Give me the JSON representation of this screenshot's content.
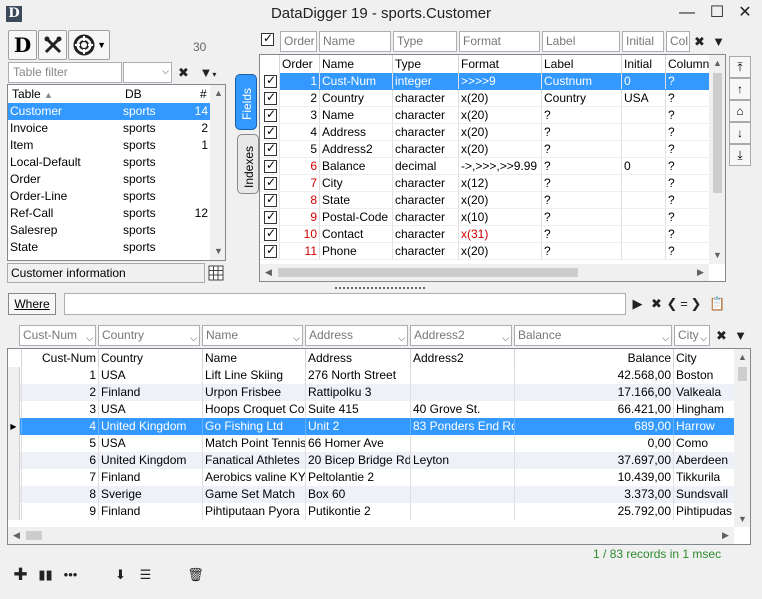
{
  "window": {
    "title": "DataDigger 19  - sports.Customer",
    "app_icon_letter": "D",
    "minimize": "—",
    "maximize": "☐",
    "close": "✕"
  },
  "toolbar": {
    "d_button": "D",
    "table_count": "30"
  },
  "table_browser": {
    "filter_placeholder": "Table filter",
    "headers": {
      "table": "Table",
      "db": "DB",
      "count": "#"
    },
    "rows": [
      {
        "table": "Customer",
        "db": "sports",
        "count": "14",
        "selected": true
      },
      {
        "table": "Invoice",
        "db": "sports",
        "count": "2"
      },
      {
        "table": "Item",
        "db": "sports",
        "count": "1"
      },
      {
        "table": "Local-Default",
        "db": "sports",
        "count": ""
      },
      {
        "table": "Order",
        "db": "sports",
        "count": ""
      },
      {
        "table": "Order-Line",
        "db": "sports",
        "count": ""
      },
      {
        "table": "Ref-Call",
        "db": "sports",
        "count": "12"
      },
      {
        "table": "Salesrep",
        "db": "sports",
        "count": ""
      },
      {
        "table": "State",
        "db": "sports",
        "count": ""
      }
    ],
    "description": "Customer information"
  },
  "side_tabs": {
    "fields": "Fields",
    "indexes": "Indexes"
  },
  "fields_panel": {
    "filters": [
      "Order",
      "Name",
      "Type",
      "Format",
      "Label",
      "Initial",
      "Col"
    ],
    "headers": [
      "Order",
      "Name",
      "Type",
      "Format",
      "Label",
      "Initial",
      "Column L"
    ],
    "rows": [
      {
        "order": "1",
        "name": "Cust-Num",
        "type": "integer",
        "format": ">>>>9",
        "label": "Custnum",
        "initial": "0",
        "col": "?",
        "selected": true
      },
      {
        "order": "2",
        "name": "Country",
        "type": "character",
        "format": "x(20)",
        "label": "Country",
        "initial": "USA",
        "col": "?"
      },
      {
        "order": "3",
        "name": "Name",
        "type": "character",
        "format": "x(20)",
        "label": "?",
        "initial": "",
        "col": "?"
      },
      {
        "order": "4",
        "name": "Address",
        "type": "character",
        "format": "x(20)",
        "label": "?",
        "initial": "",
        "col": "?"
      },
      {
        "order": "5",
        "name": "Address2",
        "type": "character",
        "format": "x(20)",
        "label": "?",
        "initial": "",
        "col": "?"
      },
      {
        "order": "6",
        "name": "Balance",
        "type": "decimal",
        "format": "->,>>>,>>9.99",
        "label": "?",
        "initial": "0",
        "col": "?"
      },
      {
        "order": "7",
        "name": "City",
        "type": "character",
        "format": "x(12)",
        "label": "?",
        "initial": "",
        "col": "?"
      },
      {
        "order": "8",
        "name": "State",
        "type": "character",
        "format": "x(20)",
        "label": "?",
        "initial": "",
        "col": "?"
      },
      {
        "order": "9",
        "name": "Postal-Code",
        "type": "character",
        "format": "x(10)",
        "label": "?",
        "initial": "",
        "col": "?"
      },
      {
        "order": "10",
        "name": "Contact",
        "type": "character",
        "format": "x(31)",
        "label": "?",
        "initial": "",
        "col": "?",
        "format_red": true
      },
      {
        "order": "11",
        "name": "Phone",
        "type": "character",
        "format": "x(20)",
        "label": "?",
        "initial": "",
        "col": "?"
      }
    ]
  },
  "where": {
    "button_label": "Where",
    "value": ""
  },
  "data_panel": {
    "filters": [
      "Cust-Num",
      "Country",
      "Name",
      "Address",
      "Address2",
      "Balance",
      "City"
    ],
    "headers": [
      "Cust-Num",
      "Country",
      "Name",
      "Address",
      "Address2",
      "Balance",
      "City"
    ],
    "rows": [
      {
        "num": "1",
        "country": "USA",
        "name": "Lift Line Skiing",
        "address": "276 North Street",
        "address2": "",
        "balance": "42.568,00",
        "city": "Boston"
      },
      {
        "num": "2",
        "country": "Finland",
        "name": "Urpon Frisbee",
        "address": "Rattipolku 3",
        "address2": "",
        "balance": "17.166,00",
        "city": "Valkeala"
      },
      {
        "num": "3",
        "country": "USA",
        "name": "Hoops Croquet Co.",
        "address": "Suite 415",
        "address2": "40 Grove St.",
        "balance": "66.421,00",
        "city": "Hingham"
      },
      {
        "num": "4",
        "country": "United Kingdom",
        "name": "Go Fishing Ltd",
        "address": "Unit 2",
        "address2": "83 Ponders End Rd",
        "balance": "689,00",
        "city": "Harrow",
        "selected": true
      },
      {
        "num": "5",
        "country": "USA",
        "name": "Match Point Tennis",
        "address": "66 Homer Ave",
        "address2": "",
        "balance": "0,00",
        "city": "Como"
      },
      {
        "num": "6",
        "country": "United Kingdom",
        "name": "Fanatical Athletes",
        "address": "20 Bicep Bridge Rd",
        "address2": "Leyton",
        "balance": "37.697,00",
        "city": "Aberdeen"
      },
      {
        "num": "7",
        "country": "Finland",
        "name": "Aerobics valine KY",
        "address": "Peltolantie 2",
        "address2": "",
        "balance": "10.439,00",
        "city": "Tikkurila"
      },
      {
        "num": "8",
        "country": "Sverige",
        "name": "Game Set Match",
        "address": "Box 60",
        "address2": "",
        "balance": "3.373,00",
        "city": "Sundsvall"
      },
      {
        "num": "9",
        "country": "Finland",
        "name": "Pihtiputaan Pyora",
        "address": "Putikontie 2",
        "address2": "",
        "balance": "25.792,00",
        "city": "Pihtipudas"
      }
    ]
  },
  "status": {
    "position": "1",
    "records": "/ 83 records in 1 msec"
  },
  "colors": {
    "selection": "#3399ff",
    "status_green": "#2e8b2e",
    "red_text": "#d00000"
  }
}
